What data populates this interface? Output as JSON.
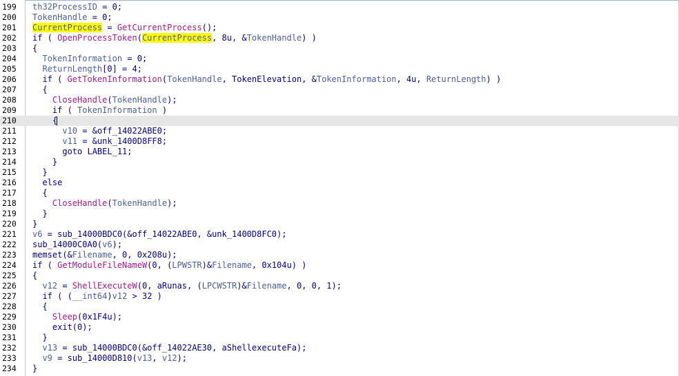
{
  "lines": [
    {
      "n": "199",
      "indent": "",
      "tokens": [
        {
          "t": "th32ProcessID",
          "c": "var"
        },
        {
          "t": " = 0;"
        }
      ]
    },
    {
      "n": "200",
      "indent": "",
      "tokens": [
        {
          "t": "TokenHandle",
          "c": "var"
        },
        {
          "t": " = 0;"
        }
      ]
    },
    {
      "n": "201",
      "indent": "",
      "tokens": [
        {
          "t": "CurrentProcess",
          "c": "var",
          "hl": true
        },
        {
          "t": " = "
        },
        {
          "t": "GetCurrentProcess",
          "c": "fn"
        },
        {
          "t": "();"
        }
      ]
    },
    {
      "n": "202",
      "indent": "",
      "tokens": [
        {
          "t": "if ( "
        },
        {
          "t": "OpenProcessToken",
          "c": "fn"
        },
        {
          "t": "("
        },
        {
          "t": "CurrentProcess",
          "c": "var",
          "hl": true
        },
        {
          "t": ", 8u, &"
        },
        {
          "t": "TokenHandle",
          "c": "var"
        },
        {
          "t": ") )"
        }
      ]
    },
    {
      "n": "203",
      "indent": "",
      "tokens": [
        {
          "t": "{"
        }
      ]
    },
    {
      "n": "204",
      "indent": "  ",
      "tokens": [
        {
          "t": "TokenInformation",
          "c": "var"
        },
        {
          "t": " = 0;"
        }
      ]
    },
    {
      "n": "205",
      "indent": "  ",
      "tokens": [
        {
          "t": "ReturnLength",
          "c": "var"
        },
        {
          "t": "[0] = 4;"
        }
      ]
    },
    {
      "n": "206",
      "indent": "  ",
      "tokens": [
        {
          "t": "if ( "
        },
        {
          "t": "GetTokenInformation",
          "c": "fn"
        },
        {
          "t": "("
        },
        {
          "t": "TokenHandle",
          "c": "var"
        },
        {
          "t": ", TokenElevation, &"
        },
        {
          "t": "TokenInformation",
          "c": "var"
        },
        {
          "t": ", 4u, "
        },
        {
          "t": "ReturnLength",
          "c": "var"
        },
        {
          "t": ") )"
        }
      ]
    },
    {
      "n": "207",
      "indent": "  ",
      "tokens": [
        {
          "t": "{"
        }
      ]
    },
    {
      "n": "208",
      "indent": "    ",
      "tokens": [
        {
          "t": "CloseHandle",
          "c": "fn"
        },
        {
          "t": "("
        },
        {
          "t": "TokenHandle",
          "c": "var"
        },
        {
          "t": ");"
        }
      ]
    },
    {
      "n": "209",
      "indent": "    ",
      "tokens": [
        {
          "t": "if ( "
        },
        {
          "t": "TokenInformation",
          "c": "var"
        },
        {
          "t": " )"
        }
      ]
    },
    {
      "n": "210",
      "indent": "    ",
      "current": true,
      "tokens": [
        {
          "t": "{"
        },
        {
          "t": "",
          "caret": true
        }
      ]
    },
    {
      "n": "211",
      "indent": "      ",
      "tokens": [
        {
          "t": "v10",
          "c": "var"
        },
        {
          "t": " = &off_14022ABE0;"
        }
      ]
    },
    {
      "n": "212",
      "indent": "      ",
      "tokens": [
        {
          "t": "v11",
          "c": "var"
        },
        {
          "t": " = &unk_1400D8FF8;"
        }
      ]
    },
    {
      "n": "213",
      "indent": "      ",
      "tokens": [
        {
          "t": "goto LABEL_11;"
        }
      ]
    },
    {
      "n": "214",
      "indent": "    ",
      "tokens": [
        {
          "t": "}"
        }
      ]
    },
    {
      "n": "215",
      "indent": "  ",
      "tokens": [
        {
          "t": "}"
        }
      ]
    },
    {
      "n": "216",
      "indent": "  ",
      "tokens": [
        {
          "t": "else"
        }
      ]
    },
    {
      "n": "217",
      "indent": "  ",
      "tokens": [
        {
          "t": "{"
        }
      ]
    },
    {
      "n": "218",
      "indent": "    ",
      "tokens": [
        {
          "t": "CloseHandle",
          "c": "fn"
        },
        {
          "t": "("
        },
        {
          "t": "TokenHandle",
          "c": "var"
        },
        {
          "t": ");"
        }
      ]
    },
    {
      "n": "219",
      "indent": "  ",
      "tokens": [
        {
          "t": "}"
        }
      ]
    },
    {
      "n": "220",
      "indent": "",
      "tokens": [
        {
          "t": "}"
        }
      ]
    },
    {
      "n": "221",
      "indent": "",
      "tokens": [
        {
          "t": "v6",
          "c": "var"
        },
        {
          "t": " = sub_14000BDC0(&off_14022ABE0, &unk_1400D8FC0);"
        }
      ]
    },
    {
      "n": "222",
      "indent": "",
      "tokens": [
        {
          "t": "sub_14000C0A0("
        },
        {
          "t": "v6",
          "c": "var"
        },
        {
          "t": ");"
        }
      ]
    },
    {
      "n": "223",
      "indent": "",
      "tokens": [
        {
          "t": "memset(&"
        },
        {
          "t": "Filename",
          "c": "var"
        },
        {
          "t": ", 0, 0x208u);"
        }
      ]
    },
    {
      "n": "224",
      "indent": "",
      "tokens": [
        {
          "t": "if ( "
        },
        {
          "t": "GetModuleFileNameW",
          "c": "fn"
        },
        {
          "t": "(0, ("
        },
        {
          "t": "LPWSTR",
          "c": "var"
        },
        {
          "t": ")&"
        },
        {
          "t": "Filename",
          "c": "var"
        },
        {
          "t": ", 0x104u) )"
        }
      ]
    },
    {
      "n": "225",
      "indent": "",
      "tokens": [
        {
          "t": "{"
        }
      ]
    },
    {
      "n": "226",
      "indent": "  ",
      "tokens": [
        {
          "t": "v12",
          "c": "var"
        },
        {
          "t": " = "
        },
        {
          "t": "ShellExecuteW",
          "c": "fn"
        },
        {
          "t": "(0, aRunas, ("
        },
        {
          "t": "LPCWSTR",
          "c": "var"
        },
        {
          "t": ")&"
        },
        {
          "t": "Filename",
          "c": "var"
        },
        {
          "t": ", 0, 0, 1);"
        }
      ]
    },
    {
      "n": "227",
      "indent": "  ",
      "tokens": [
        {
          "t": "if ( ("
        },
        {
          "t": "__int64",
          "c": "var"
        },
        {
          "t": ")"
        },
        {
          "t": "v12",
          "c": "var"
        },
        {
          "t": " > 32 )"
        }
      ]
    },
    {
      "n": "228",
      "indent": "  ",
      "tokens": [
        {
          "t": "{"
        }
      ]
    },
    {
      "n": "229",
      "indent": "    ",
      "tokens": [
        {
          "t": "Sleep",
          "c": "fn"
        },
        {
          "t": "(0x1F4u);"
        }
      ]
    },
    {
      "n": "230",
      "indent": "    ",
      "tokens": [
        {
          "t": "exit(0);"
        }
      ]
    },
    {
      "n": "231",
      "indent": "  ",
      "tokens": [
        {
          "t": "}"
        }
      ]
    },
    {
      "n": "232",
      "indent": "  ",
      "tokens": [
        {
          "t": "v13",
          "c": "var"
        },
        {
          "t": " = sub_14000BDC0(&off_14022AE30, aShellexecuteFa);"
        }
      ]
    },
    {
      "n": "233",
      "indent": "  ",
      "tokens": [
        {
          "t": "v9",
          "c": "var"
        },
        {
          "t": " = sub_14000D810("
        },
        {
          "t": "v13",
          "c": "var"
        },
        {
          "t": ", "
        },
        {
          "t": "v12",
          "c": "var"
        },
        {
          "t": ");"
        }
      ]
    },
    {
      "n": "234",
      "indent": "",
      "tokens": [
        {
          "t": "}"
        }
      ]
    }
  ],
  "colors": {
    "keyword": "#000080",
    "variable": "#4b5e9b",
    "function": "#a01a8c",
    "highlight": "#ffff00",
    "current_line": "#e6e6e6"
  }
}
